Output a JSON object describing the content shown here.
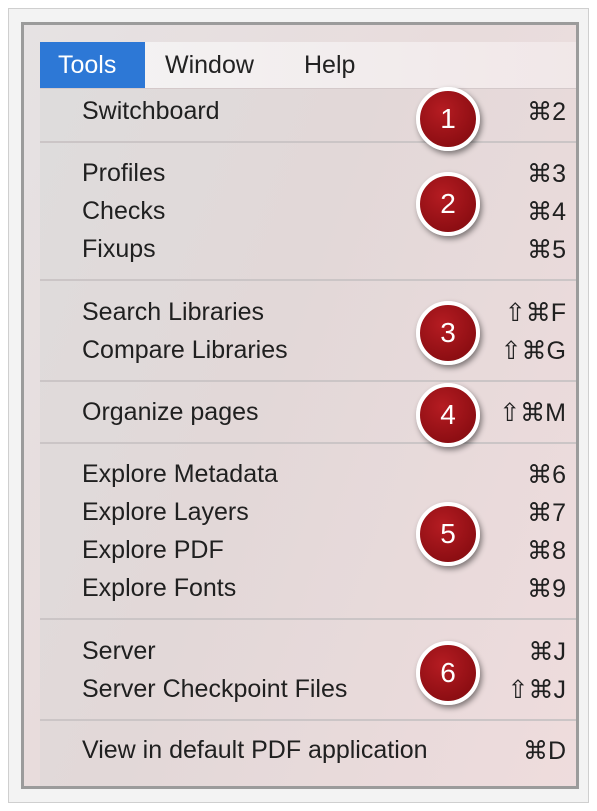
{
  "menubar": {
    "items": [
      {
        "label": "Tools"
      },
      {
        "label": "Window"
      },
      {
        "label": "Help"
      }
    ]
  },
  "menu": {
    "groups": [
      {
        "badge": "1",
        "items": [
          {
            "label": "Switchboard",
            "shortcut": "⌘2"
          }
        ]
      },
      {
        "badge": "2",
        "items": [
          {
            "label": "Profiles",
            "shortcut": "⌘3"
          },
          {
            "label": "Checks",
            "shortcut": "⌘4"
          },
          {
            "label": "Fixups",
            "shortcut": "⌘5"
          }
        ]
      },
      {
        "badge": "3",
        "items": [
          {
            "label": "Search Libraries",
            "shortcut": "⇧⌘F"
          },
          {
            "label": "Compare Libraries",
            "shortcut": "⇧⌘G"
          }
        ]
      },
      {
        "badge": "4",
        "items": [
          {
            "label": "Organize pages",
            "shortcut": "⇧⌘M"
          }
        ]
      },
      {
        "badge": "5",
        "items": [
          {
            "label": "Explore Metadata",
            "shortcut": "⌘6"
          },
          {
            "label": "Explore Layers",
            "shortcut": "⌘7"
          },
          {
            "label": "Explore PDF",
            "shortcut": "⌘8"
          },
          {
            "label": "Explore Fonts",
            "shortcut": "⌘9"
          }
        ]
      },
      {
        "badge": "6",
        "items": [
          {
            "label": "Server",
            "shortcut": "⌘J"
          },
          {
            "label": "Server Checkpoint Files",
            "shortcut": "⇧⌘J"
          }
        ]
      },
      {
        "badge": "",
        "items": [
          {
            "label": "View in default PDF application",
            "shortcut": "⌘D"
          }
        ]
      }
    ]
  },
  "colors": {
    "menubar_active": "#2d78d6",
    "badge": "#8e0e13"
  }
}
